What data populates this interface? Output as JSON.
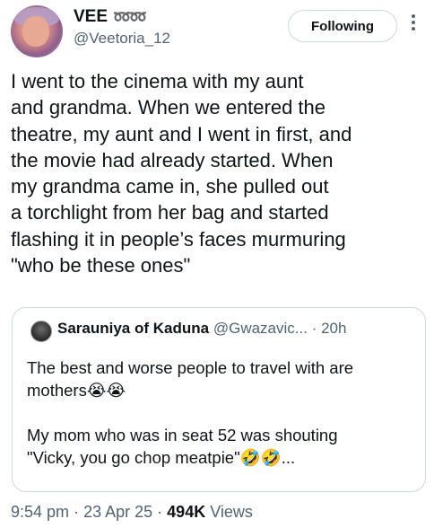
{
  "author": {
    "display_name": "VEE",
    "name_emoji": "➿➿",
    "handle": "@Veetoria_12"
  },
  "follow_button": {
    "label": "Following"
  },
  "tweet": {
    "text": "I went to the cinema with my aunt\nand grandma. When we entered the\ntheatre, my aunt and I went in first, and\nthe movie had already started. When\nmy grandma came in, she pulled out\na torchlight from her bag and started\nflashing it in people’s faces murmuring\n\"who be these ones\""
  },
  "quoted_tweet": {
    "name": "Sarauniya of Kaduna",
    "handle": "@Gwazavic...",
    "time": "· 20h",
    "text": "The best and worse people to travel with are\nmothers😭😭\n\nMy mom who was in seat 52 was shouting\n\"Vicky, you go chop meatpie\"🤣🤣..."
  },
  "meta": {
    "time": "9:54 pm",
    "sep1": "·",
    "date": "23 Apr 25",
    "sep2": "·",
    "views_count": "494K",
    "views_label": "Views"
  }
}
